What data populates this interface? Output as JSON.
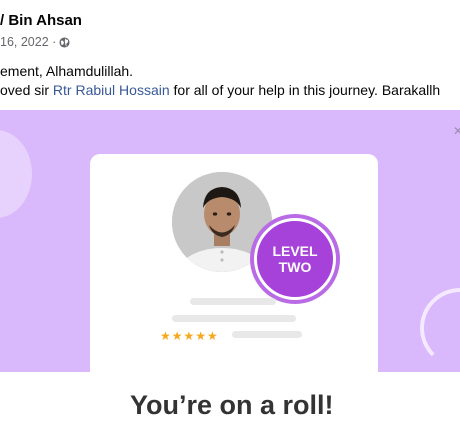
{
  "post": {
    "author": "/ Bin Ahsan",
    "date": "16, 2022 ·",
    "text_line1": "ement, Alhamdulillah.",
    "text_line2_before": "oved sir ",
    "mention": "Rtr Rabiul Hossain",
    "text_line2_after": " for all of your help in this journey. Barakallh"
  },
  "badge": {
    "line1": "LEVEL",
    "line2": "TWO"
  },
  "stars": "★★★★★",
  "headline": "You’re on a roll!",
  "colors": {
    "banner": "#d9b8fb",
    "badge": "#a642d9",
    "link": "#385898"
  },
  "icons": {
    "privacy": "globe-icon",
    "close": "close-icon"
  }
}
